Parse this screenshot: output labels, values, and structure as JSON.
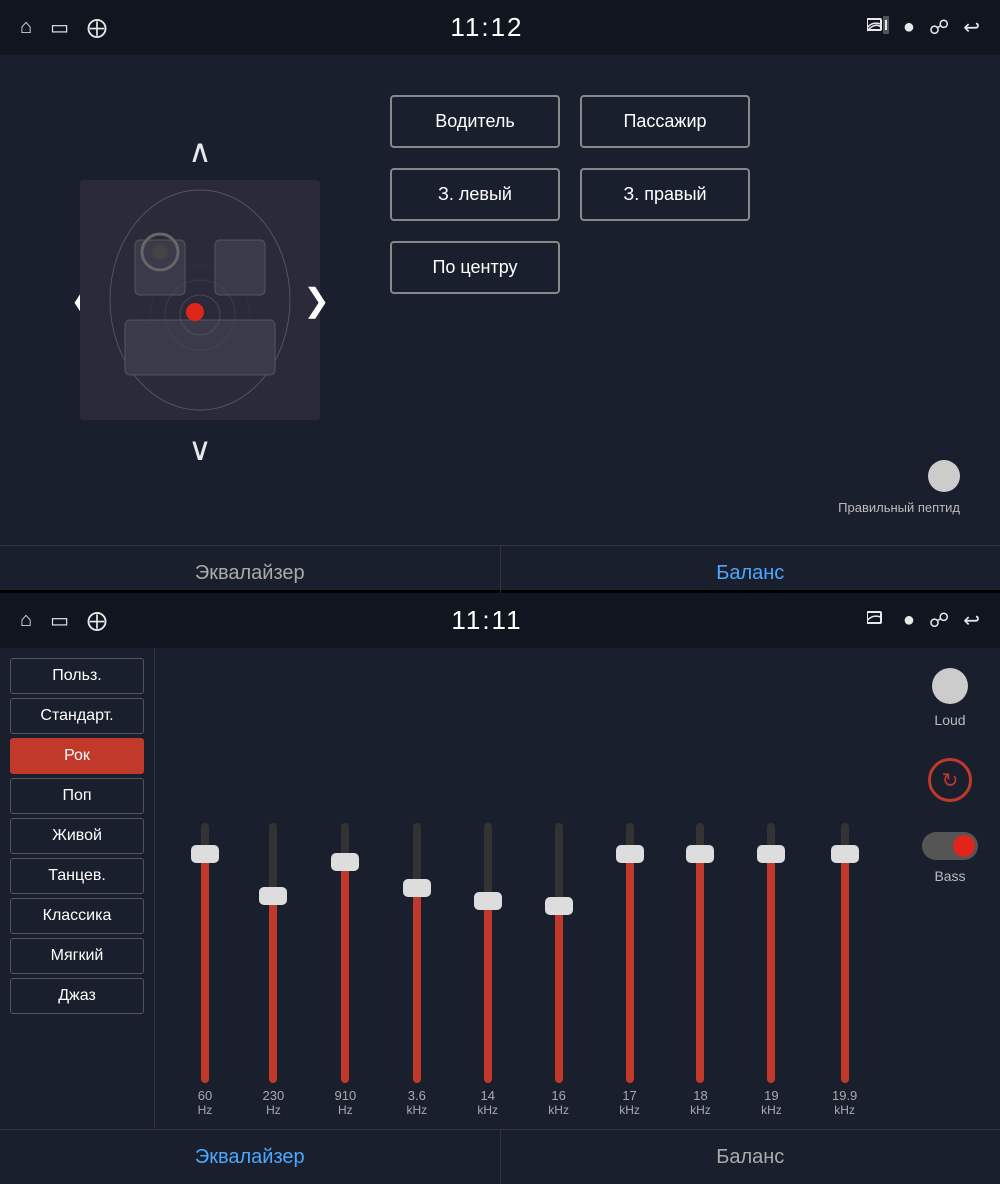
{
  "top": {
    "statusBar": {
      "time": "11:12",
      "leftIcons": [
        "home-icon",
        "screen-icon",
        "usb-icon"
      ],
      "rightIcons": [
        "cast-icon",
        "location-icon",
        "bluetooth-icon",
        "back-icon"
      ]
    },
    "seatButtons": {
      "driver": "Водитель",
      "passenger": "Пассажир",
      "rearLeft": "З. левый",
      "rearRight": "З. правый",
      "center": "По центру"
    },
    "toggleLabel": "Правильный пептид",
    "tabs": [
      {
        "id": "equalizer",
        "label": "Эквалайзер",
        "active": false
      },
      {
        "id": "balance",
        "label": "Баланс",
        "active": true
      }
    ]
  },
  "bottom": {
    "statusBar": {
      "time": "11:11"
    },
    "presets": [
      {
        "id": "user",
        "label": "Польз.",
        "active": false
      },
      {
        "id": "standard",
        "label": "Стандарт.",
        "active": false
      },
      {
        "id": "rock",
        "label": "Рок",
        "active": true
      },
      {
        "id": "pop",
        "label": "Поп",
        "active": false
      },
      {
        "id": "live",
        "label": "Живой",
        "active": false
      },
      {
        "id": "dance",
        "label": "Танцев.",
        "active": false
      },
      {
        "id": "classic",
        "label": "Классика",
        "active": false
      },
      {
        "id": "soft",
        "label": "Мягкий",
        "active": false
      },
      {
        "id": "jazz",
        "label": "Джаз",
        "active": false
      }
    ],
    "sliders": [
      {
        "freq": "60",
        "unit": "Hz",
        "fillPct": 88,
        "thumbPct": 88
      },
      {
        "freq": "230",
        "unit": "Hz",
        "fillPct": 72,
        "thumbPct": 72
      },
      {
        "freq": "910",
        "unit": "Hz",
        "fillPct": 85,
        "thumbPct": 85
      },
      {
        "freq": "3.6",
        "unit": "kHz",
        "fillPct": 75,
        "thumbPct": 75
      },
      {
        "freq": "14",
        "unit": "kHz",
        "fillPct": 70,
        "thumbPct": 70
      },
      {
        "freq": "16",
        "unit": "kHz",
        "fillPct": 68,
        "thumbPct": 68
      },
      {
        "freq": "17",
        "unit": "kHz",
        "fillPct": 88,
        "thumbPct": 88
      },
      {
        "freq": "18",
        "unit": "kHz",
        "fillPct": 88,
        "thumbPct": 88
      },
      {
        "freq": "19",
        "unit": "kHz",
        "fillPct": 88,
        "thumbPct": 88
      },
      {
        "freq": "19.9",
        "unit": "kHz",
        "fillPct": 88,
        "thumbPct": 88
      }
    ],
    "loudLabel": "Loud",
    "bassLabel": "Bass",
    "tabs": [
      {
        "id": "equalizer",
        "label": "Эквалайзер",
        "active": true
      },
      {
        "id": "balance",
        "label": "Баланс",
        "active": false
      }
    ]
  }
}
